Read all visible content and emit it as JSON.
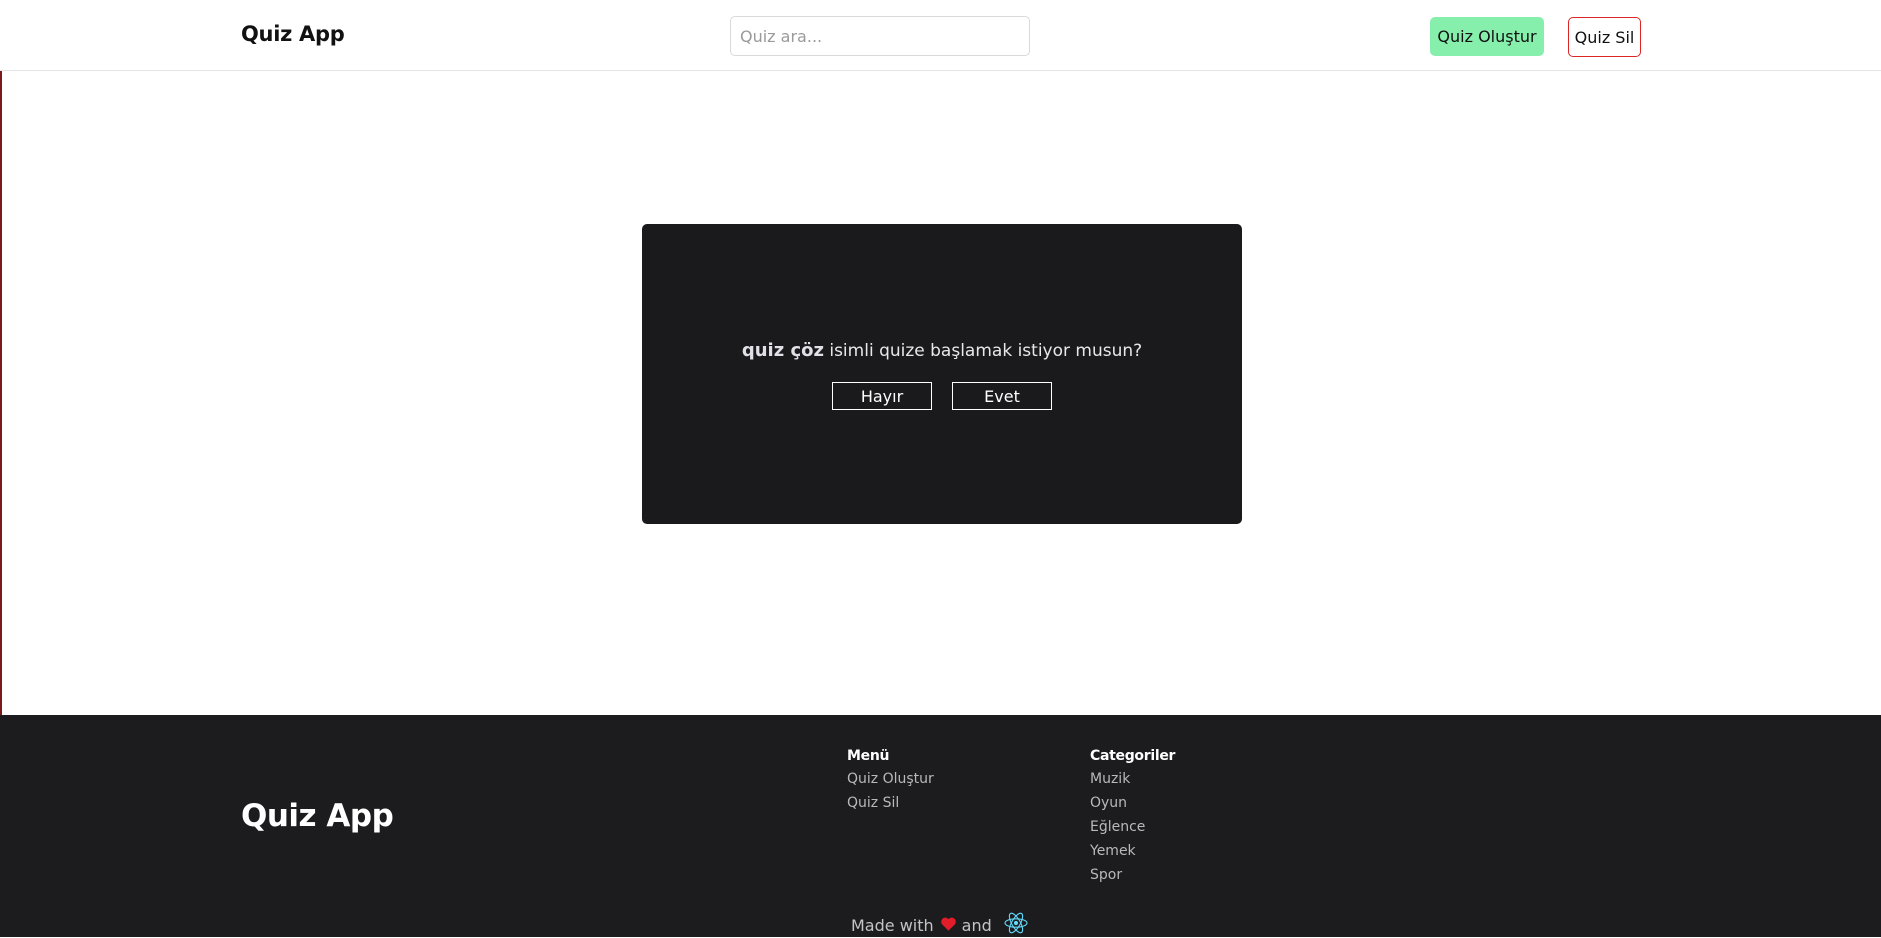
{
  "header": {
    "brand": "Quiz App",
    "search_placeholder": "Quiz ara...",
    "create_label": "Quiz Oluştur",
    "delete_label": "Quiz Sil"
  },
  "modal": {
    "quiz_name": "quiz çöz",
    "question_text": " isimli quize başlamak istiyor musun?",
    "no_label": "Hayır",
    "yes_label": "Evet"
  },
  "footer": {
    "brand": "Quiz App",
    "menu": {
      "title": "Menü",
      "items": [
        {
          "label": "Quiz Oluştur"
        },
        {
          "label": "Quiz Sil"
        }
      ]
    },
    "categories": {
      "title": "Categoriler",
      "items": [
        {
          "label": "Muzik"
        },
        {
          "label": "Oyun"
        },
        {
          "label": "Eğlence"
        },
        {
          "label": "Yemek"
        },
        {
          "label": "Spor"
        }
      ]
    },
    "made_with": "Made with",
    "and": "and",
    "heart_icon": "heart-icon",
    "react_icon": "react-logo-icon"
  },
  "colors": {
    "create_button_bg": "#86efac",
    "delete_button_border": "#dc2626",
    "dark_surface": "#1a1a1d",
    "heart": "#e11d2a",
    "react": "#61dafb"
  }
}
